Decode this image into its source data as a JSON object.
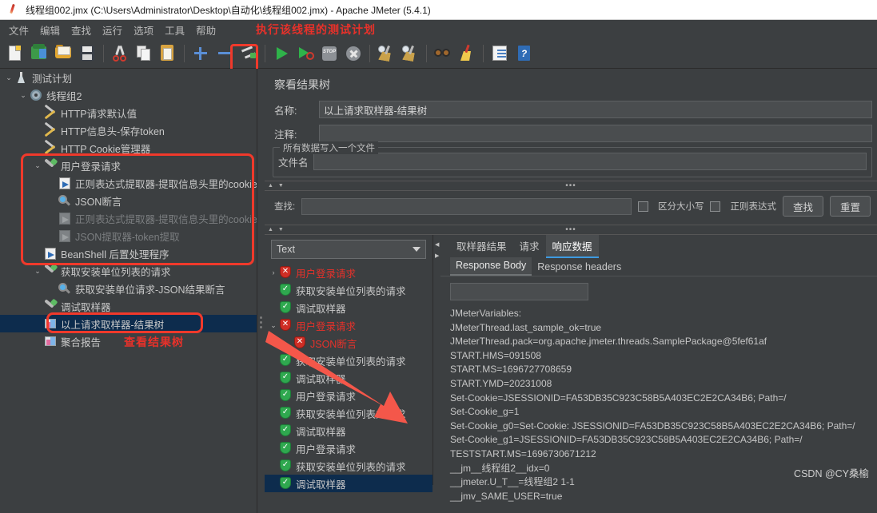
{
  "window": {
    "title": "线程组002.jmx (C:\\Users\\Administrator\\Desktop\\自动化\\线程组002.jmx) - Apache JMeter (5.4.1)",
    "app_icon": "jmeter-feather-icon"
  },
  "menubar": {
    "items": [
      "文件",
      "编辑",
      "查找",
      "运行",
      "选项",
      "工具",
      "帮助"
    ],
    "annotation": "执行该线程的测试计划"
  },
  "toolbar": {
    "buttons": [
      {
        "name": "new-test-plan-button",
        "icon": "new-document-icon"
      },
      {
        "name": "templates-button",
        "icon": "templates-icon"
      },
      {
        "name": "open-button",
        "icon": "open-folder-icon"
      },
      {
        "name": "save-button",
        "icon": "floppy-disk-icon"
      },
      {
        "name": "cut-button",
        "icon": "scissors-icon"
      },
      {
        "name": "copy-button",
        "icon": "copy-icon"
      },
      {
        "name": "paste-button",
        "icon": "clipboard-icon"
      },
      {
        "name": "expand-all-button",
        "icon": "plus-icon"
      },
      {
        "name": "collapse-all-button",
        "icon": "minus-icon"
      },
      {
        "name": "toggle-button",
        "icon": "toggle-icon"
      },
      {
        "name": "start-button",
        "icon": "play-icon"
      },
      {
        "name": "start-no-pauses-button",
        "icon": "play-no-pauses-icon"
      },
      {
        "name": "stop-button",
        "icon": "stop-icon"
      },
      {
        "name": "shutdown-button",
        "icon": "shutdown-icon"
      },
      {
        "name": "clear-button",
        "icon": "broom-icon"
      },
      {
        "name": "clear-all-button",
        "icon": "broom-all-icon"
      },
      {
        "name": "search-button",
        "icon": "binoculars-icon"
      },
      {
        "name": "reset-search-button",
        "icon": "brush-icon"
      },
      {
        "name": "log-viewer-button",
        "icon": "log-icon"
      },
      {
        "name": "help-button",
        "icon": "help-book-icon"
      }
    ],
    "stop_label": "STOP",
    "help_glyph": "?"
  },
  "tree": {
    "nodes": [
      {
        "label": "测试计划",
        "indent": 0,
        "twist": "v",
        "icon": "test-plan-icon",
        "state": "normal"
      },
      {
        "label": "线程组2",
        "indent": 1,
        "twist": "v",
        "icon": "thread-group-icon",
        "state": "normal"
      },
      {
        "label": "HTTP请求默认值",
        "indent": 2,
        "twist": "",
        "icon": "config-wrench-icon",
        "state": "normal"
      },
      {
        "label": "HTTP信息头-保存token",
        "indent": 2,
        "twist": "",
        "icon": "config-wrench-icon",
        "state": "normal"
      },
      {
        "label": "HTTP Cookie管理器",
        "indent": 2,
        "twist": "",
        "icon": "config-wrench-icon",
        "state": "normal"
      },
      {
        "label": "用户登录请求",
        "indent": 2,
        "twist": "v",
        "icon": "sampler-icon",
        "state": "normal"
      },
      {
        "label": "正则表达式提取器-提取信息头里的cookie",
        "indent": 3,
        "twist": "",
        "icon": "post-processor-icon",
        "state": "normal"
      },
      {
        "label": "JSON断言",
        "indent": 3,
        "twist": "",
        "icon": "assertion-icon",
        "state": "normal"
      },
      {
        "label": "正则表达式提取器-提取信息头里的cookie",
        "indent": 3,
        "twist": "",
        "icon": "post-processor-icon",
        "state": "disabled"
      },
      {
        "label": "JSON提取器-token提取",
        "indent": 3,
        "twist": "",
        "icon": "post-processor-icon",
        "state": "disabled"
      },
      {
        "label": "BeanShell 后置处理程序",
        "indent": 2,
        "twist": "",
        "icon": "post-processor-icon",
        "state": "normal"
      },
      {
        "label": "获取安装单位列表的请求",
        "indent": 2,
        "twist": "v",
        "icon": "sampler-icon",
        "state": "normal"
      },
      {
        "label": "获取安装单位请求-JSON结果断言",
        "indent": 3,
        "twist": "",
        "icon": "assertion-icon",
        "state": "normal"
      },
      {
        "label": "调试取样器",
        "indent": 2,
        "twist": "",
        "icon": "sampler-icon",
        "state": "normal"
      },
      {
        "label": "以上请求取样器-结果树",
        "indent": 2,
        "twist": "",
        "icon": "listener-chart-icon",
        "state": "selected"
      },
      {
        "label": "聚合报告",
        "indent": 2,
        "twist": "",
        "icon": "listener-chart-icon",
        "state": "normal"
      }
    ],
    "annotation_view_result_tree": "查看结果树"
  },
  "editor": {
    "title": "察看结果树",
    "name_label": "名称:",
    "name_value": "以上请求取样器-结果树",
    "comment_label": "注释:",
    "comment_value": "",
    "group_title": "所有数据写入一个文件",
    "filename_label": "文件名",
    "filename_value": "",
    "search_label": "查找:",
    "search_value": "",
    "case_sensitive_label": "区分大小写",
    "regex_label": "正则表达式",
    "find_button": "查找",
    "reset_button": "重置",
    "renderer_selected": "Text"
  },
  "result_tree": {
    "rows": [
      {
        "label": "用户登录请求",
        "status": "error",
        "twist": ">",
        "indent": 0,
        "selected": false
      },
      {
        "label": "获取安装单位列表的请求",
        "status": "ok",
        "twist": "",
        "indent": 0,
        "selected": false
      },
      {
        "label": "调试取样器",
        "status": "ok",
        "twist": "",
        "indent": 0,
        "selected": false
      },
      {
        "label": "用户登录请求",
        "status": "error",
        "twist": "v",
        "indent": 0,
        "selected": false
      },
      {
        "label": "JSON断言",
        "status": "error",
        "twist": "",
        "indent": 1,
        "selected": false
      },
      {
        "label": "获取安装单位列表的请求",
        "status": "ok",
        "twist": "",
        "indent": 0,
        "selected": false
      },
      {
        "label": "调试取样器",
        "status": "ok",
        "twist": "",
        "indent": 0,
        "selected": false
      },
      {
        "label": "用户登录请求",
        "status": "ok",
        "twist": "",
        "indent": 0,
        "selected": false
      },
      {
        "label": "获取安装单位列表的请求",
        "status": "ok",
        "twist": "",
        "indent": 0,
        "selected": false
      },
      {
        "label": "调试取样器",
        "status": "ok",
        "twist": "",
        "indent": 0,
        "selected": false
      },
      {
        "label": "用户登录请求",
        "status": "ok",
        "twist": "",
        "indent": 0,
        "selected": false
      },
      {
        "label": "获取安装单位列表的请求",
        "status": "ok",
        "twist": "",
        "indent": 0,
        "selected": false
      },
      {
        "label": "调试取样器",
        "status": "ok",
        "twist": "",
        "indent": 0,
        "selected": true
      }
    ],
    "ok_mark": "✓",
    "err_mark": "✕"
  },
  "detail": {
    "tabs": [
      {
        "label": "取样器结果",
        "active": false
      },
      {
        "label": "请求",
        "active": false
      },
      {
        "label": "响应数据",
        "active": true
      }
    ],
    "subtabs": [
      {
        "label": "Response Body",
        "active": true
      },
      {
        "label": "Response headers",
        "active": false
      }
    ],
    "filter_value": "",
    "body_lines": [
      "JMeterVariables:",
      "JMeterThread.last_sample_ok=true",
      "JMeterThread.pack=org.apache.jmeter.threads.SamplePackage@5fef61af",
      "START.HMS=091508",
      "START.MS=1696727708659",
      "START.YMD=20231008",
      "Set-Cookie=JSESSIONID=FA53DB35C923C58B5A403EC2E2CA34B6; Path=/",
      "Set-Cookie_g=1",
      "Set-Cookie_g0=Set-Cookie: JSESSIONID=FA53DB35C923C58B5A403EC2E2CA34B6; Path=/",
      "Set-Cookie_g1=JSESSIONID=FA53DB35C923C58B5A403EC2E2CA34B6; Path=/",
      "TESTSTART.MS=1696730671212",
      "__jm__线程组2__idx=0",
      "__jmeter.U_T__=线程组2 1-1",
      "__jmv_SAME_USER=true"
    ]
  },
  "watermark": "CSDN @CY桑榆",
  "colors": {
    "accent_red": "#e8312a",
    "selection_blue": "#0d2c4d",
    "tab_underline": "#3d9ae0",
    "ok_green": "#2fa84f",
    "panel_bg": "#3c3f41"
  }
}
